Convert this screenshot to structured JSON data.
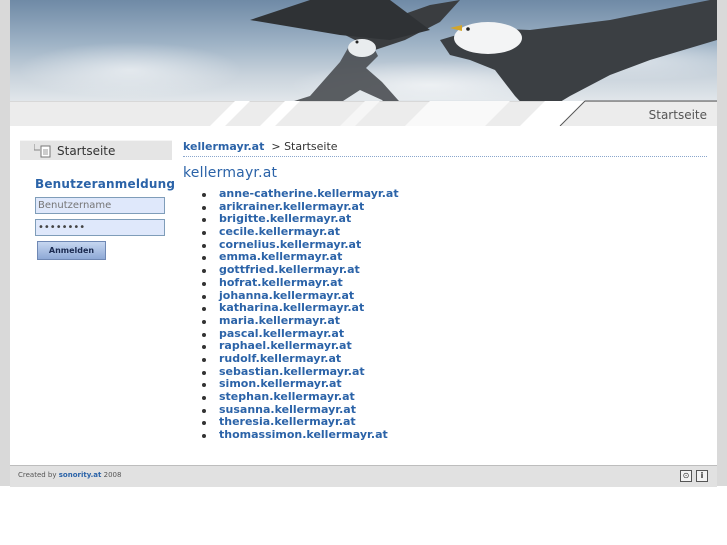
{
  "banner": {
    "page_label": "Startseite"
  },
  "sidebar": {
    "nav_item": "Startseite",
    "login_heading": "Benutzeranmeldung",
    "username_placeholder": "Benutzername",
    "password_value": "••••••••",
    "login_button": "Anmelden"
  },
  "breadcrumb": {
    "home": "kellermayr.at",
    "separator": ">",
    "current": "Startseite"
  },
  "main": {
    "title": "kellermayr.at",
    "links": [
      "anne-catherine.kellermayr.at",
      "arikrainer.kellermayr.at",
      "brigitte.kellermayr.at",
      "cecile.kellermayr.at",
      "cornelius.kellermayr.at",
      "emma.kellermayr.at",
      "gottfried.kellermayr.at",
      "hofrat.kellermayr.at",
      "johanna.kellermayr.at",
      "katharina.kellermayr.at",
      "maria.kellermayr.at",
      "pascal.kellermayr.at",
      "raphael.kellermayr.at",
      "rudolf.kellermayr.at",
      "sebastian.kellermayr.at",
      "simon.kellermayr.at",
      "stephan.kellermayr.at",
      "susanna.kellermayr.at",
      "theresia.kellermayr.at",
      "thomassimon.kellermayr.at"
    ]
  },
  "footer": {
    "created_by": "Created by",
    "company": "sonority.at",
    "year": "2008",
    "icon1": "⊙",
    "icon2": "i"
  },
  "colors": {
    "link": "#2b63a8",
    "accent": "#8ea9d6",
    "frame": "#d9d9d9"
  }
}
